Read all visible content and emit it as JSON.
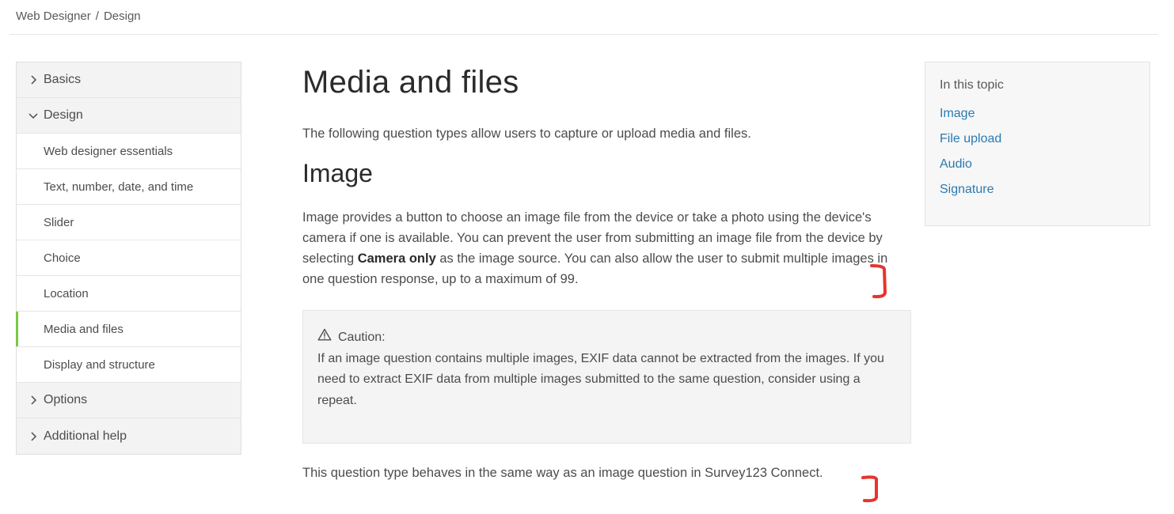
{
  "breadcrumb": {
    "root": "Web Designer",
    "sep": "/",
    "current": "Design"
  },
  "sidebar": {
    "items": [
      {
        "label": "Basics",
        "type": "group",
        "icon": "chevron-right-icon"
      },
      {
        "label": "Design",
        "type": "group",
        "icon": "chevron-down-icon"
      },
      {
        "label": "Web designer essentials",
        "type": "sub"
      },
      {
        "label": "Text, number, date, and time",
        "type": "sub"
      },
      {
        "label": "Slider",
        "type": "sub"
      },
      {
        "label": "Choice",
        "type": "sub"
      },
      {
        "label": "Location",
        "type": "sub"
      },
      {
        "label": "Media and files",
        "type": "sub",
        "active": true
      },
      {
        "label": "Display and structure",
        "type": "sub"
      },
      {
        "label": "Options",
        "type": "group",
        "icon": "chevron-right-icon"
      },
      {
        "label": "Additional help",
        "type": "group",
        "icon": "chevron-right-icon"
      }
    ],
    "active_color": "#7ac943"
  },
  "main": {
    "title": "Media and files",
    "intro": "The following question types allow users to capture or upload media and files.",
    "section_title": "Image",
    "para_part1": "Image provides a button to choose an image file from the device or take a photo using the device's camera if one is available. You can prevent the user from submitting an image file from the device by selecting ",
    "para_bold": "Camera only",
    "para_part2": " as the image source. You can also allow the user to submit multiple images in one question response, up to a maximum of 99.",
    "caution": {
      "title": "Caution:",
      "icon": "warning-icon",
      "text": "If an image question contains multiple images, EXIF data cannot be extracted from the images. If you need to extract EXIF data from multiple images submitted to the same question, consider using a repeat."
    },
    "last": "This question type behaves in the same way as an image question in Survey123 Connect."
  },
  "toc": {
    "title": "In this topic",
    "links": [
      "Image",
      "File upload",
      "Audio",
      "Signature"
    ],
    "link_color": "#2a7ab0"
  },
  "annotation_color": "#e8332f"
}
